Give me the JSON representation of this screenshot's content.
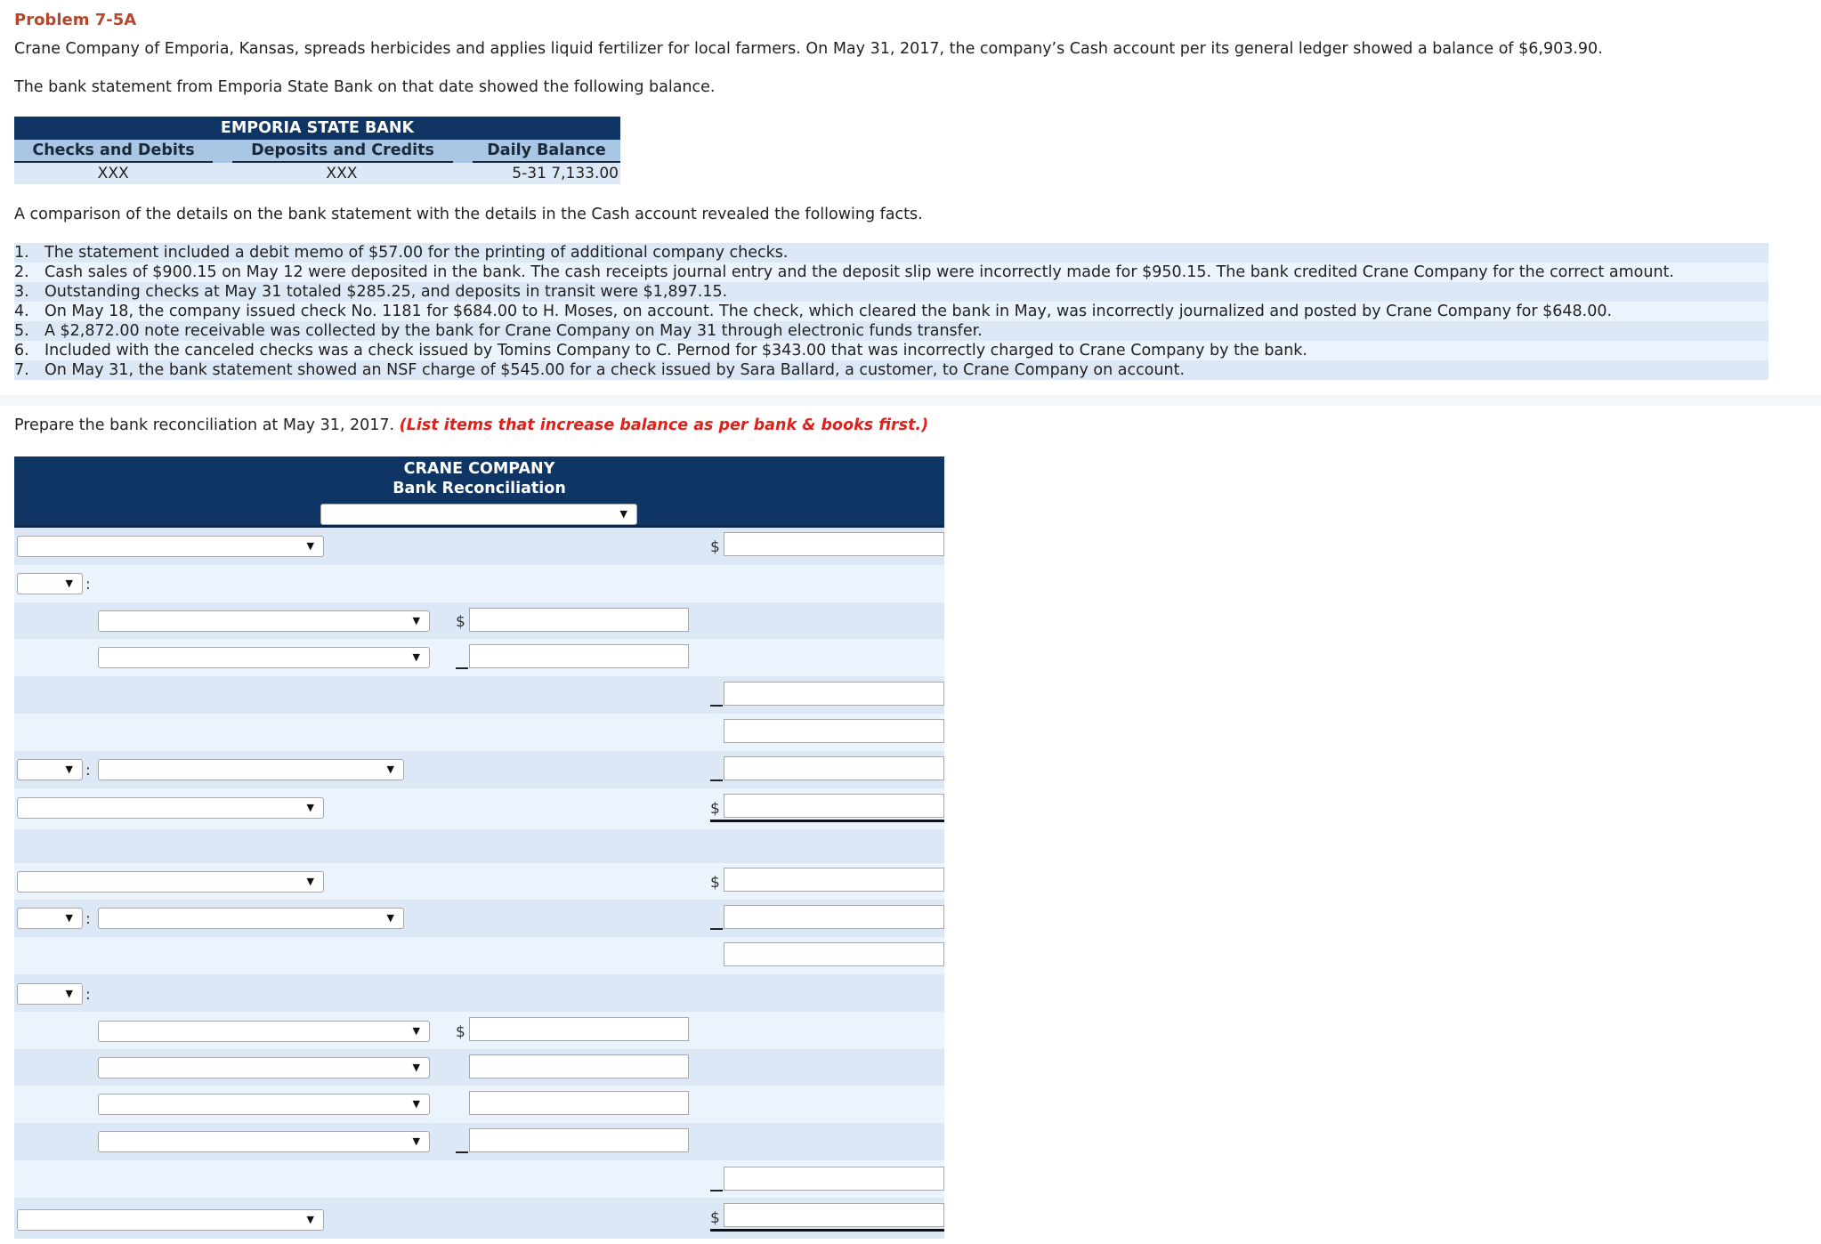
{
  "problem": {
    "title": "Problem 7-5A",
    "intro": "Crane Company of Emporia, Kansas, spreads herbicides and applies liquid fertilizer for local farmers. On May 31, 2017, the company’s Cash account per its general ledger showed a balance of $6,903.90.",
    "bank_intro": "The bank statement from Emporia State Bank on that date showed the following balance."
  },
  "bank_table": {
    "title": "EMPORIA STATE BANK",
    "columns": [
      "Checks and Debits",
      "Deposits and Credits",
      "Daily Balance"
    ],
    "row": [
      "XXX",
      "XXX",
      "5-31 7,133.00"
    ]
  },
  "comparison_intro": "A comparison of the details on the bank statement with the details in the Cash account revealed the following facts.",
  "facts": [
    {
      "num": "1.",
      "text": "The statement included a debit memo of $57.00 for the printing of additional company checks."
    },
    {
      "num": "2.",
      "text": "Cash sales of $900.15 on May 12 were deposited in the bank. The cash receipts journal entry and the deposit slip were incorrectly made for $950.15. The bank credited Crane Company for the correct amount."
    },
    {
      "num": "3.",
      "text": "Outstanding checks at May 31 totaled $285.25, and deposits in transit were $1,897.15."
    },
    {
      "num": "4.",
      "text": "On May 18, the company issued check No. 1181 for $684.00 to H. Moses, on account. The check, which cleared the bank in May, was incorrectly journalized and posted by Crane Company for $648.00."
    },
    {
      "num": "5.",
      "text": "A $2,872.00 note receivable was collected by the bank for Crane Company on May 31 through electronic funds transfer."
    },
    {
      "num": "6.",
      "text": "Included with the canceled checks was a check issued by Tomins Company to C. Pernod for $343.00 that was incorrectly charged to Crane Company by the bank."
    },
    {
      "num": "7.",
      "text": "On May 31, the bank statement showed an NSF charge of $545.00 for a check issued by Sara Ballard, a customer, to Crane Company on account."
    }
  ],
  "instruction": {
    "text": "Prepare the bank reconciliation at May 31, 2017.",
    "note": "(List items that increase balance as per bank & books first.)"
  },
  "reconciliation": {
    "company": "CRANE COMPANY",
    "subtitle": "Bank Reconciliation",
    "date_select": "",
    "symbols": {
      "dollar": "$",
      "colon": ":",
      "arrow": "▼"
    },
    "fields": {
      "r1_select": "",
      "r1_amount": "",
      "r2_type": "",
      "r3_select": "",
      "r3_amount": "",
      "r4_select": "",
      "r4_amount": "",
      "r5_amount": "",
      "r6_amount": "",
      "r7_type": "",
      "r7_select": "",
      "r7_amount": "",
      "r8_select": "",
      "r8_amount": "",
      "r10_select": "",
      "r10_amount": "",
      "r11_type": "",
      "r11_select": "",
      "r11_amount": "",
      "r12_amount": "",
      "r13_type": "",
      "r14_select": "",
      "r14_amount": "",
      "r15_select": "",
      "r15_amount": "",
      "r16_select": "",
      "r16_amount": "",
      "r17_select": "",
      "r17_amount": "",
      "r18_amount": "",
      "r19_select": "",
      "r19_amount": ""
    }
  },
  "colors": {
    "title": "#b7472a",
    "header_bg": "#0f3564",
    "note_red": "#e0201b",
    "row_odd": "#dde8f6",
    "row_even": "#ebf3fd"
  }
}
